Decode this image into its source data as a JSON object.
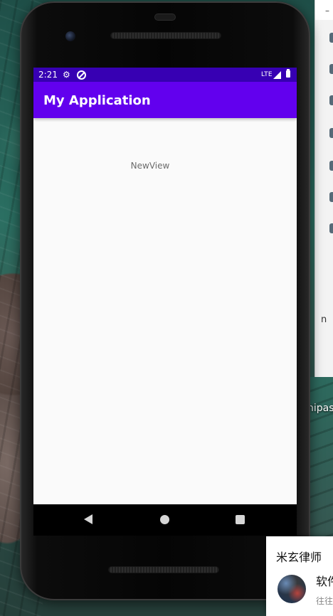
{
  "emulator": {
    "status_bar": {
      "time": "2:21",
      "network": "LTE"
    },
    "app_bar": {
      "title": "My Application"
    },
    "content": {
      "text": "NewView"
    },
    "colors": {
      "status_bar": "#3700b3",
      "app_bar": "#6200ee",
      "screen_background": "#fafafa"
    }
  },
  "desktop": {
    "side_window_fragment": "n",
    "background_text_fragment": "nipas",
    "notification": {
      "sender": "米玄律师",
      "title": "软件",
      "snippet": "往往"
    }
  }
}
